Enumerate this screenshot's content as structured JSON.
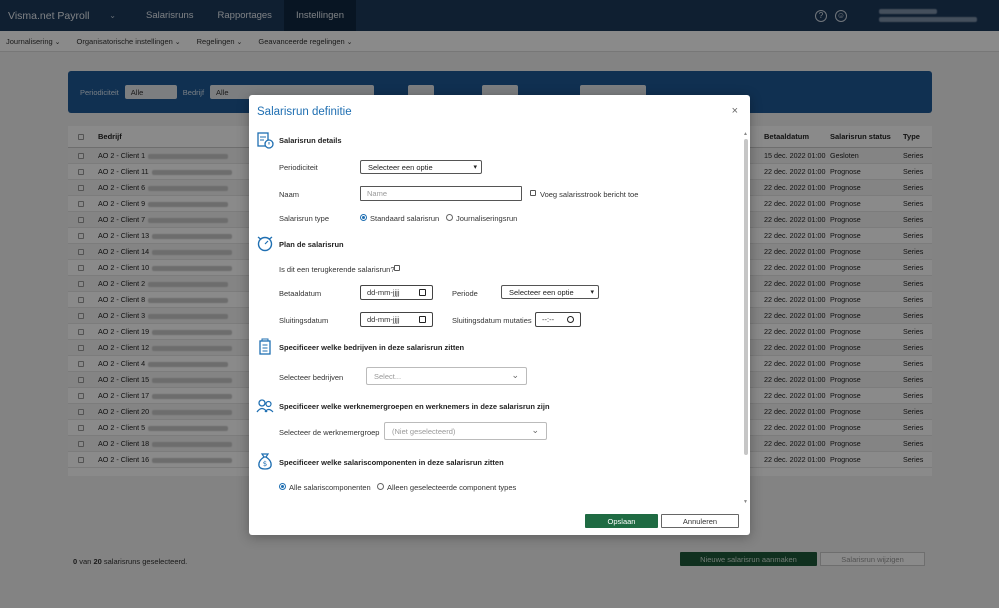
{
  "app": {
    "brand": "Visma.net Payroll",
    "nav": [
      "Salarisruns",
      "Rapportages",
      "Instellingen"
    ],
    "active_nav": "Instellingen"
  },
  "subnav": [
    "Journalisering",
    "Organisatorische instellingen",
    "Regelingen",
    "Geavanceerde regelingen"
  ],
  "filters": {
    "periodiciteit_label": "Periodiciteit",
    "periodiciteit_value": "Alle",
    "bedrijf_label": "Bedrijf",
    "bedrijf_value": "Alle"
  },
  "table": {
    "headers": {
      "company": "Bedrijf",
      "paydate": "Betaaldatum",
      "status": "Salarisrun status",
      "type": "Type"
    },
    "rows": [
      {
        "company": "AO 2 - Client 1",
        "paydate": "15 dec. 2022 01:00",
        "status": "Gesloten",
        "type": "Series"
      },
      {
        "company": "AO 2 - Client 11",
        "paydate": "22 dec. 2022 01:00",
        "status": "Prognose",
        "type": "Series"
      },
      {
        "company": "AO 2 - Client 6",
        "paydate": "22 dec. 2022 01:00",
        "status": "Prognose",
        "type": "Series"
      },
      {
        "company": "AO 2 - Client 9",
        "paydate": "22 dec. 2022 01:00",
        "status": "Prognose",
        "type": "Series"
      },
      {
        "company": "AO 2 - Client 7",
        "paydate": "22 dec. 2022 01:00",
        "status": "Prognose",
        "type": "Series"
      },
      {
        "company": "AO 2 - Client 13",
        "paydate": "22 dec. 2022 01:00",
        "status": "Prognose",
        "type": "Series"
      },
      {
        "company": "AO 2 - Client 14",
        "paydate": "22 dec. 2022 01:00",
        "status": "Prognose",
        "type": "Series"
      },
      {
        "company": "AO 2 - Client 10",
        "paydate": "22 dec. 2022 01:00",
        "status": "Prognose",
        "type": "Series"
      },
      {
        "company": "AO 2 - Client 2",
        "paydate": "22 dec. 2022 01:00",
        "status": "Prognose",
        "type": "Series"
      },
      {
        "company": "AO 2 - Client 8",
        "paydate": "22 dec. 2022 01:00",
        "status": "Prognose",
        "type": "Series"
      },
      {
        "company": "AO 2 - Client 3",
        "paydate": "22 dec. 2022 01:00",
        "status": "Prognose",
        "type": "Series"
      },
      {
        "company": "AO 2 - Client 19",
        "paydate": "22 dec. 2022 01:00",
        "status": "Prognose",
        "type": "Series"
      },
      {
        "company": "AO 2 - Client 12",
        "paydate": "22 dec. 2022 01:00",
        "status": "Prognose",
        "type": "Series"
      },
      {
        "company": "AO 2 - Client 4",
        "paydate": "22 dec. 2022 01:00",
        "status": "Prognose",
        "type": "Series"
      },
      {
        "company": "AO 2 - Client 15",
        "paydate": "22 dec. 2022 01:00",
        "status": "Prognose",
        "type": "Series"
      },
      {
        "company": "AO 2 - Client 17",
        "paydate": "22 dec. 2022 01:00",
        "status": "Prognose",
        "type": "Series"
      },
      {
        "company": "AO 2 - Client 20",
        "paydate": "22 dec. 2022 01:00",
        "status": "Prognose",
        "type": "Series"
      },
      {
        "company": "AO 2 - Client 5",
        "paydate": "22 dec. 2022 01:00",
        "status": "Prognose",
        "type": "Series"
      },
      {
        "company": "AO 2 - Client 18",
        "paydate": "22 dec. 2022 01:00",
        "status": "Prognose",
        "type": "Series"
      },
      {
        "company": "AO 2 - Client 16",
        "paydate": "22 dec. 2022 01:00",
        "status": "Prognose",
        "type": "Series"
      }
    ]
  },
  "footer": {
    "selected": "0",
    "van": "van",
    "total": "20",
    "suffix": "salarisruns geselecteerd.",
    "new_button": "Nieuwe salarisrun aanmaken",
    "edit_button": "Salarisrun wijzigen"
  },
  "modal": {
    "title": "Salarisrun definitie",
    "close": "×",
    "details": {
      "title": "Salarisrun details",
      "periodiciteit_label": "Periodiciteit",
      "periodiciteit_value": "Selecteer een optie",
      "naam_label": "Naam",
      "naam_placeholder": "Name",
      "voeg_label": "Voeg salarisstrook bericht toe",
      "type_label": "Salarisrun type",
      "type_option1": "Standaard salarisrun",
      "type_option2": "Journaliseringsrun"
    },
    "plan": {
      "title": "Plan de salarisrun",
      "recurring_label": "Is dit een terugkerende salarisrun?",
      "betaaldatum_label": "Betaaldatum",
      "betaaldatum_value": "dd-mm-jjjj",
      "periode_label": "Periode",
      "periode_value": "Selecteer een optie",
      "sluitingsdatum_label": "Sluitingsdatum",
      "sluitingsdatum_value": "dd-mm-jjjj",
      "sluitingsdatum_mut_label": "Sluitingsdatum mutaties",
      "sluitingsdatum_mut_value": "--:--"
    },
    "companies": {
      "title": "Specificeer welke bedrijven in deze salarisrun zitten",
      "label": "Selecteer bedrijven",
      "placeholder": "Select..."
    },
    "employees": {
      "title": "Specificeer welke werknemergroepen en werknemers in deze salarisrun zijn",
      "label": "Selecteer de werknemergroep",
      "placeholder": "(Niet geselecteerd)"
    },
    "components": {
      "title": "Specificeer welke salariscomponenten in deze salarisrun zitten",
      "option1": "Alle salariscomponenten",
      "option2": "Alleen geselecteerde component types"
    },
    "save": "Opslaan",
    "cancel": "Annuleren"
  }
}
